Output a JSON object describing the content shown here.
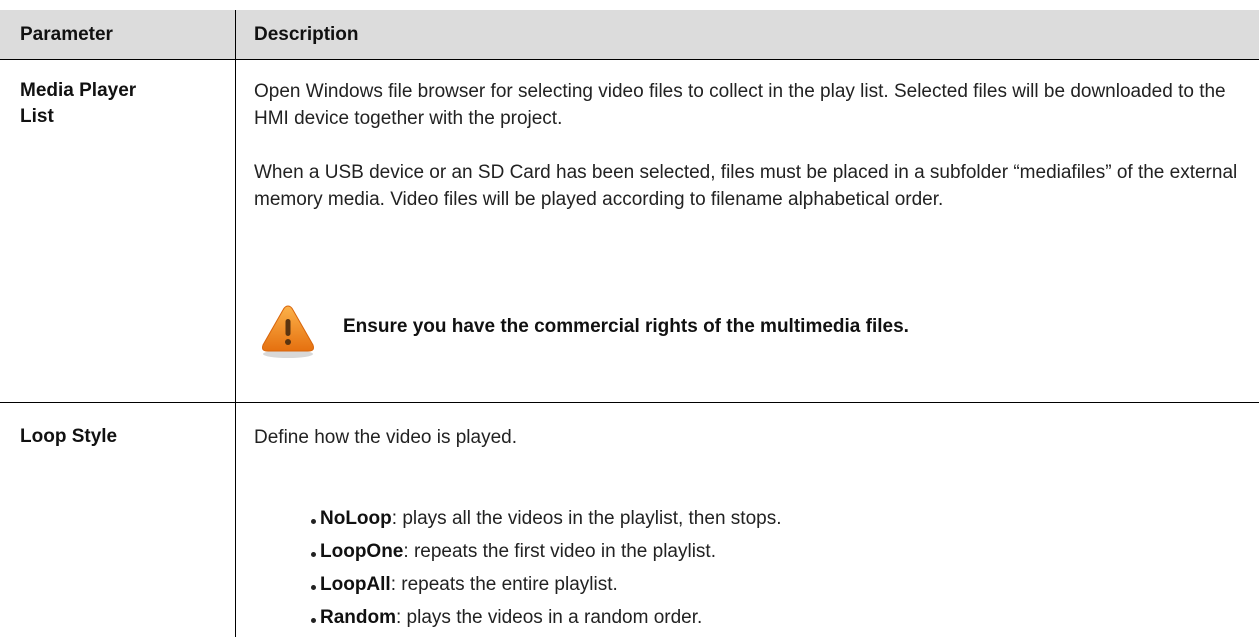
{
  "table": {
    "headers": {
      "parameter": "Parameter",
      "description": "Description"
    },
    "rows": [
      {
        "parameter_line1": "Media Player",
        "parameter_line2": "List",
        "para1": "Open Windows file browser for selecting video files to collect in the play list. Selected files will be downloaded to the HMI device together with the project.",
        "para2": "When a USB device or an SD Card has been selected, files must be placed in a subfolder “mediafiles” of the external memory media. Video files will be played according to filename alphabetical order.",
        "warning": {
          "icon": "warning-triangle-icon",
          "text": "Ensure you have the commercial rights of the multimedia files."
        }
      },
      {
        "parameter": "Loop Style",
        "intro": "Define how the video is played.",
        "options": [
          {
            "name": "NoLoop",
            "desc": ": plays all the videos in the playlist, then stops."
          },
          {
            "name": "LoopOne",
            "desc": ": repeats the first video in the playlist."
          },
          {
            "name": "LoopAll",
            "desc": ": repeats the entire playlist."
          },
          {
            "name": "Random",
            "desc": ": plays the videos in a random order."
          }
        ]
      }
    ]
  },
  "colors": {
    "header_bg": "#dcdcdc",
    "rule": "#000000",
    "warning_orange": "#f08a1c"
  }
}
